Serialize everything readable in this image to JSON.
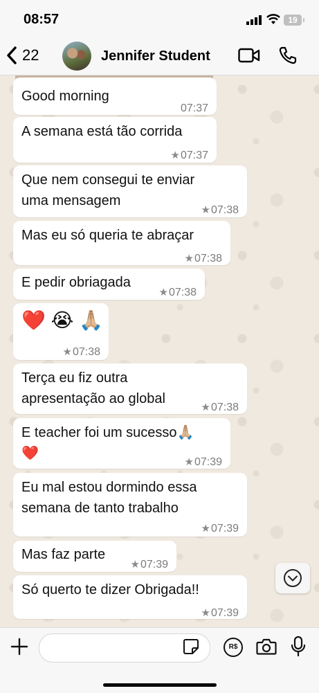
{
  "status_bar": {
    "time": "08:57",
    "battery": "19"
  },
  "header": {
    "back_count": "22",
    "contact_name": "Jennifer Student"
  },
  "messages": [
    {
      "text": "Good morning",
      "time": "07:37",
      "starred": false
    },
    {
      "text": "A semana está tão corrida",
      "time": "07:37",
      "starred": true
    },
    {
      "text": "Que nem consegui te enviar",
      "text2": "uma mensagem",
      "time": "07:38",
      "starred": true
    },
    {
      "text": "Mas eu só queria te abraçar",
      "time": "07:38",
      "starred": true
    },
    {
      "text": "E pedir obriagada",
      "time": "07:38",
      "starred": true
    },
    {
      "text": "❤️ 😭 🙏🏼",
      "time": "07:38",
      "starred": true
    },
    {
      "text": "Terça eu fiz outra",
      "text2": "apresentação ao global",
      "time": "07:38",
      "starred": true
    },
    {
      "text": "E teacher foi um sucesso🙏🏼",
      "text2": "❤️",
      "time": "07:39",
      "starred": true
    },
    {
      "text": "Eu mal estou dormindo essa",
      "text2": "semana de tanto trabalho",
      "time": "07:39",
      "starred": true
    },
    {
      "text": "Mas faz parte",
      "time": "07:39",
      "starred": true
    },
    {
      "text": "Só querto te dizer Obrigada!!",
      "time": "07:39",
      "starred": true
    }
  ],
  "input": {
    "placeholder": "",
    "currency_label": "R$"
  },
  "icons": {
    "back": "chevron-left-icon",
    "video": "video-camera-icon",
    "call": "phone-icon",
    "plus": "plus-icon",
    "sticker": "sticker-icon",
    "camera": "camera-icon",
    "mic": "microphone-icon",
    "scroll": "chevron-down-icon",
    "star": "star-icon"
  }
}
